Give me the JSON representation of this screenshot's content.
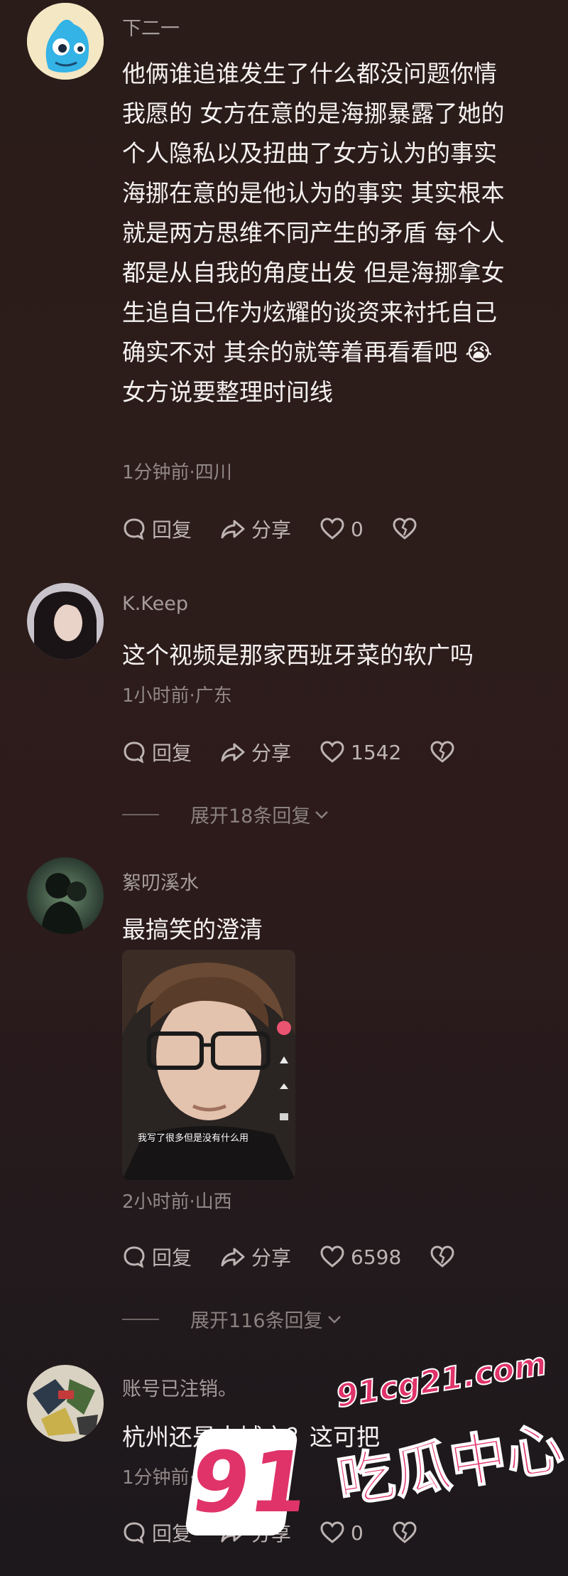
{
  "comments": [
    {
      "user": "下二一",
      "lines": [
        "他俩谁追谁发生了什么都没问题你情",
        "我愿的  女方在意的是海挪暴露了她的",
        "个人隐私以及扭曲了女方认为的事实",
        "海挪在意的是他认为的事实   其实根本",
        "就是两方思维不同产生的矛盾  每个人",
        "都是从自我的角度出发  但是海挪拿女",
        "生追自己作为炫耀的谈资来衬托自己",
        "确实不对  其余的就等着再看看吧 😭",
        "女方说要整理时间线"
      ],
      "meta": "1分钟前·四川",
      "reply": "回复",
      "share": "分享",
      "likes": "0"
    },
    {
      "user": "K.Keep",
      "text": "这个视频是那家西班牙菜的软广吗",
      "meta": "1小时前·广东",
      "reply": "回复",
      "share": "分享",
      "likes": "1542",
      "expand": "展开18条回复"
    },
    {
      "user": "絮叨溪水",
      "text": "最搞笑的澄清",
      "video_caption": "我写了很多但是没有什么用",
      "meta": "2小时前·山西",
      "reply": "回复",
      "share": "分享",
      "likes": "6598",
      "expand": "展开116条回复"
    },
    {
      "user": "账号已注销。",
      "text": "杭州还是大城市？这可把",
      "meta": "1分钟前·浙江",
      "reply": "回复",
      "share": "分享",
      "likes": "0"
    }
  ],
  "watermark": {
    "number": "91",
    "site": "91cg21.com",
    "title": "吃瓜中心"
  },
  "colors": {
    "accent": "#e0336a"
  }
}
